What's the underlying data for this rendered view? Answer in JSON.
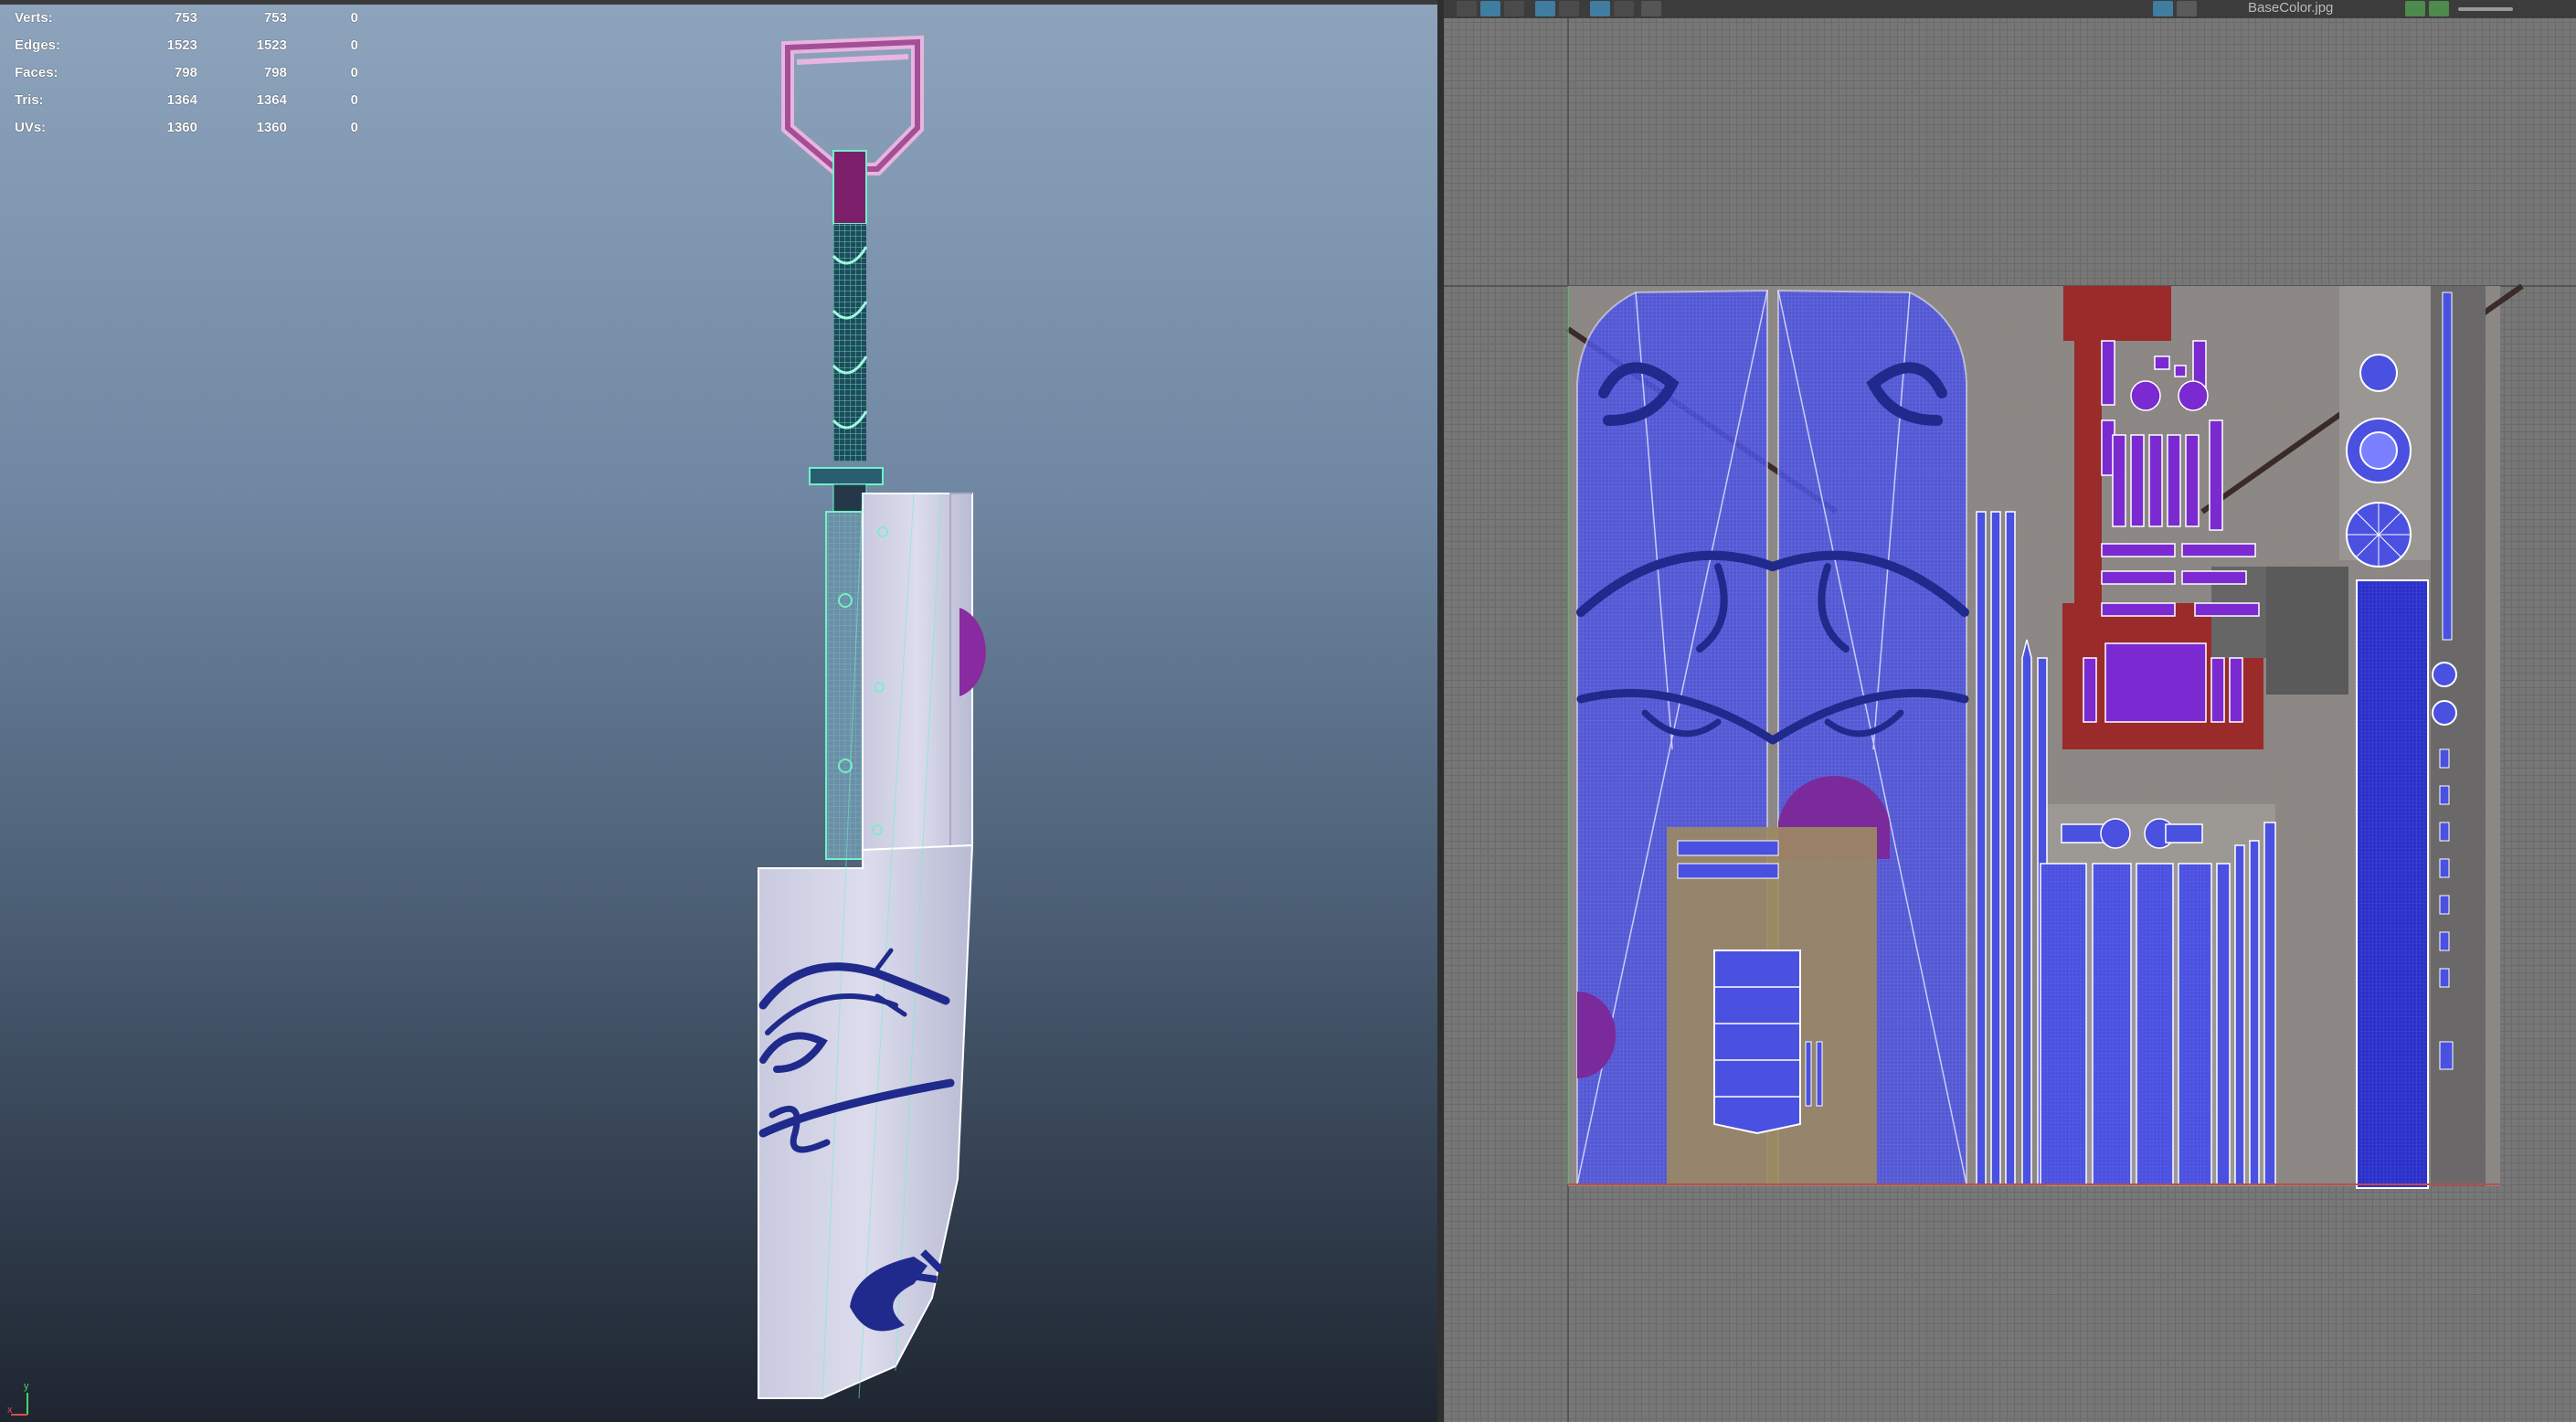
{
  "hud": {
    "rows": [
      {
        "label": "Verts:",
        "a": "753",
        "b": "753",
        "c": "0"
      },
      {
        "label": "Edges:",
        "a": "1523",
        "b": "1523",
        "c": "0"
      },
      {
        "label": "Faces:",
        "a": "798",
        "b": "798",
        "c": "0"
      },
      {
        "label": "Tris:",
        "a": "1364",
        "b": "1364",
        "c": "0"
      },
      {
        "label": "UVs:",
        "a": "1360",
        "b": "1360",
        "c": "0"
      }
    ]
  },
  "axis": {
    "y": "y",
    "x": "x"
  },
  "uv_editor": {
    "texture_name": "BaseColor.jpg",
    "toolbar_icons": [
      "grid-icon",
      "shaded-icon",
      "checker-icon",
      "uv-shell-icon",
      "frame-icon",
      "filter-icon",
      "isolate-icon",
      "snapshot-icon",
      "texture-icon",
      "checker-toggle-icon",
      "dropdown-icon",
      "tile-icon",
      "color-icon",
      "slider-icon"
    ]
  },
  "colors": {
    "viewport_top": "#8ea4bd",
    "viewport_bottom": "#1e2530",
    "uv_blue": "#3b3fd8",
    "dragon": "#1f2a8c",
    "magenta": "#7a2a9a",
    "wire_cyan": "#6ff2c6",
    "handle_pink": "#d8a0d0",
    "texture_red": "#9b2a2a"
  }
}
